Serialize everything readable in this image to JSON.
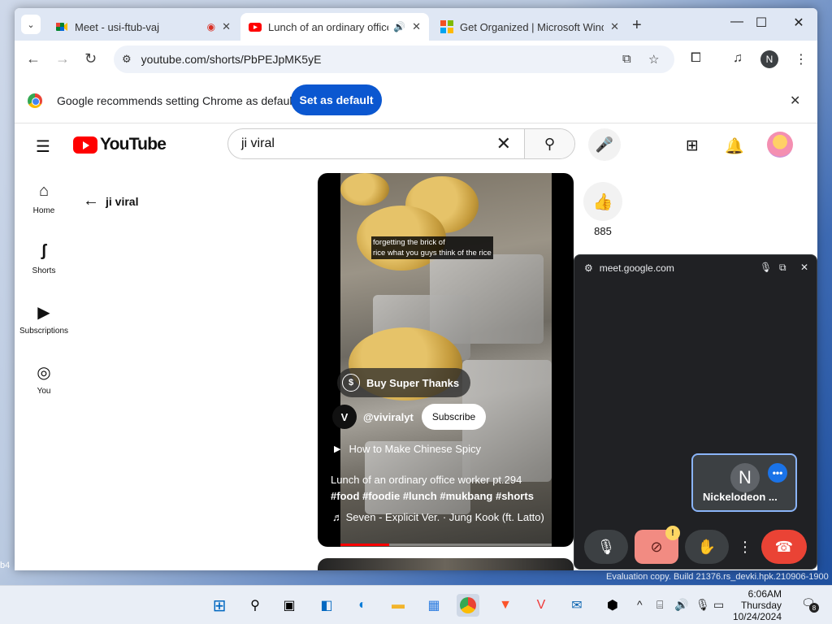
{
  "browser": {
    "tabs": [
      {
        "title": "Meet - usi-ftub-vaj"
      },
      {
        "title": "Lunch of an ordinary office"
      },
      {
        "title": "Get Organized | Microsoft Wind"
      }
    ],
    "url": "youtube.com/shorts/PbPEJpMK5yE",
    "profile_initial": "N",
    "infobar_text": "Google recommends setting Chrome as default",
    "set_default_label": "Set as default"
  },
  "youtube": {
    "logo_text": "YouTube",
    "search_query": "ji viral",
    "sidebar": [
      {
        "label": "Home",
        "icon": "home-icon"
      },
      {
        "label": "Shorts",
        "icon": "shorts-icon"
      },
      {
        "label": "Subscriptions",
        "icon": "subscriptions-icon"
      },
      {
        "label": "You",
        "icon": "you-icon"
      }
    ],
    "back_label": "ji viral",
    "short": {
      "caption_line1": "forgetting the brick of",
      "caption_line2": "rice what you guys think of the rice",
      "super_thanks": "Buy Super Thanks",
      "channel": "@viviralyt",
      "subscribe": "Subscribe",
      "playlist": "How to Make Chinese Spicy",
      "title": "Lunch of an ordinary office worker pt.294",
      "hashtags": "#food #foodie #lunch #mukbang #shorts",
      "music": "Seven - Explicit Ver. · Jung Kook (ft. Latto)",
      "progress": 0.23
    },
    "like_count": "885"
  },
  "meet_pip": {
    "site": "meet.google.com",
    "participant_initial": "N",
    "participant_name": "Nickelodeon ..."
  },
  "desktop": {
    "eval_text": "Evaluation copy. Build 21376.rs_devki.hpk.210906-1900",
    "left_fragment": "b4"
  },
  "taskbar": {
    "time": "6:06AM",
    "day": "Thursday",
    "date": "10/24/2024",
    "notif_count": "8"
  },
  "colors": {
    "accent": "#0b57d0",
    "youtube_red": "#ff0000",
    "meet_end": "#ea4335"
  }
}
